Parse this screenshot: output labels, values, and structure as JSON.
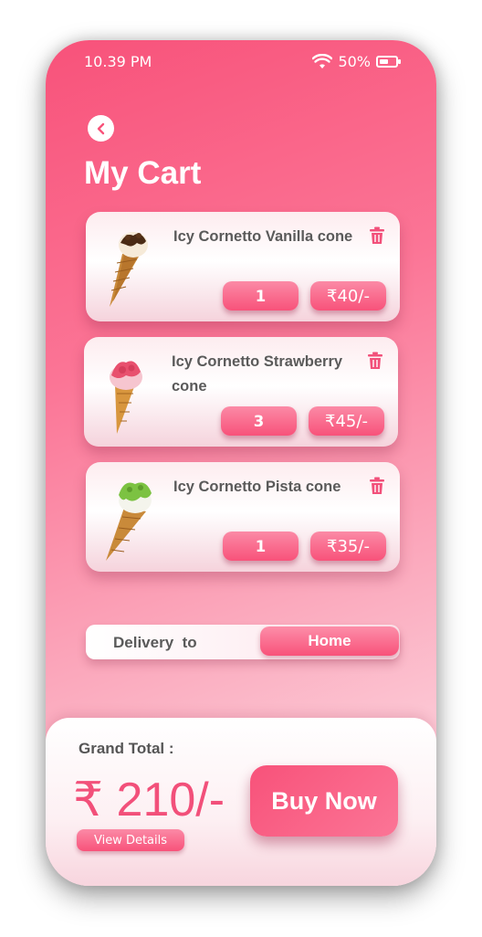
{
  "status_bar": {
    "time": "10.39 PM",
    "battery": "50%"
  },
  "header": {
    "title": "My Cart"
  },
  "cart": {
    "items": [
      {
        "name": "Icy Cornetto Vanilla cone",
        "quantity": "1",
        "price": "₹40/-",
        "flavor": "vanilla"
      },
      {
        "name": "Icy Cornetto Strawberry cone",
        "quantity": "3",
        "price": "₹45/-",
        "flavor": "strawberry"
      },
      {
        "name": "Icy Cornetto Pista cone",
        "quantity": "1",
        "price": "₹35/-",
        "flavor": "pista"
      }
    ]
  },
  "delivery": {
    "label": "Delivery  to",
    "option": "Home"
  },
  "footer": {
    "grand_total_label": "Grand Total :",
    "grand_total_value": "₹ 210/-",
    "view_details": "View Details",
    "buy_now": "Buy Now"
  },
  "colors": {
    "accent": "#f8527a",
    "accent_light": "#fb8aa6",
    "text_dark": "#5a5a5a"
  },
  "icons": [
    "wifi-icon",
    "battery-icon",
    "back-arrow-icon",
    "trash-icon",
    "rupee-icon"
  ]
}
